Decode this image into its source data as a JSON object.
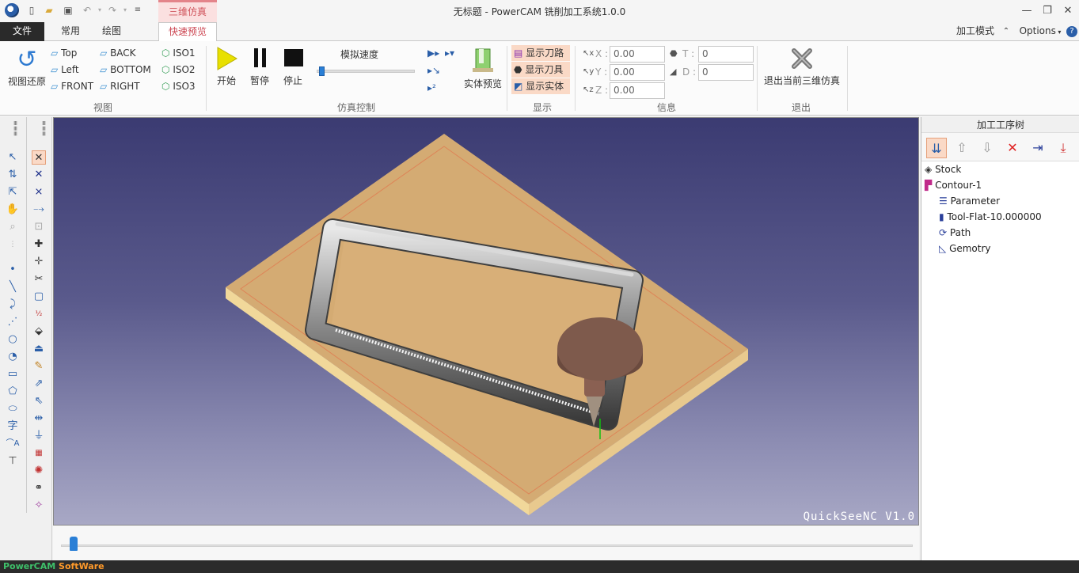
{
  "title_bar": {
    "app_title": "无标题 - PowerCAM 铣削加工系统1.0.0",
    "context_tab": "三维仿真",
    "window_controls": [
      "minimize-icon",
      "restore-icon",
      "close-icon"
    ]
  },
  "tabs": {
    "file": "文件",
    "common": "常用",
    "draw": "绘图",
    "quick_preview": "快速预览",
    "right_mode": "加工模式",
    "right_options": "Options"
  },
  "ribbon": {
    "view_group": {
      "label": "视图",
      "restore": "视图还原",
      "top": "Top",
      "left": "Left",
      "front": "FRONT",
      "back": "BACK",
      "bottom": "BOTTOM",
      "right": "RIGHT",
      "iso1": "ISO1",
      "iso2": "ISO2",
      "iso3": "ISO3"
    },
    "sim_group": {
      "label": "仿真控制",
      "start": "开始",
      "pause": "暂停",
      "stop": "停止",
      "speed_label": "模拟速度",
      "speed_value": 0.02,
      "solid_preview": "实体预览"
    },
    "display_group": {
      "label": "显示",
      "show_path": "显示刀路",
      "show_tool": "显示刀具",
      "show_solid": "显示实体"
    },
    "info_group": {
      "label": "信息",
      "x_label": "X :",
      "x_value": "0.00",
      "y_label": "Y :",
      "y_value": "0.00",
      "z_label": "Z :",
      "z_value": "0.00",
      "t_label": "T :",
      "t_value": "0",
      "d_label": "D :",
      "d_value": "0"
    },
    "exit_group": {
      "label": "退出",
      "exit_button": "退出当前三维仿真"
    }
  },
  "viewport": {
    "watermark": "QuickSeeNC V1.0"
  },
  "timeline": {
    "position": 0.01
  },
  "panel": {
    "title": "加工工序树",
    "tree": [
      {
        "label": "Stock",
        "icon": "stock-icon"
      },
      {
        "label": "Contour-1",
        "icon": "operation-icon"
      },
      {
        "label": "Parameter",
        "icon": "parameter-icon"
      },
      {
        "label": "Tool-Flat-10.000000",
        "icon": "tool-icon"
      },
      {
        "label": "Path",
        "icon": "path-icon"
      },
      {
        "label": "Gemotry",
        "icon": "geometry-icon"
      }
    ]
  },
  "status_bar": {
    "brand_a": "PowerCAM",
    "brand_b": "SoftWare"
  },
  "colors": {
    "accent_red": "#cc4450",
    "stock": "#d9b077",
    "tool": "#7a5648"
  }
}
